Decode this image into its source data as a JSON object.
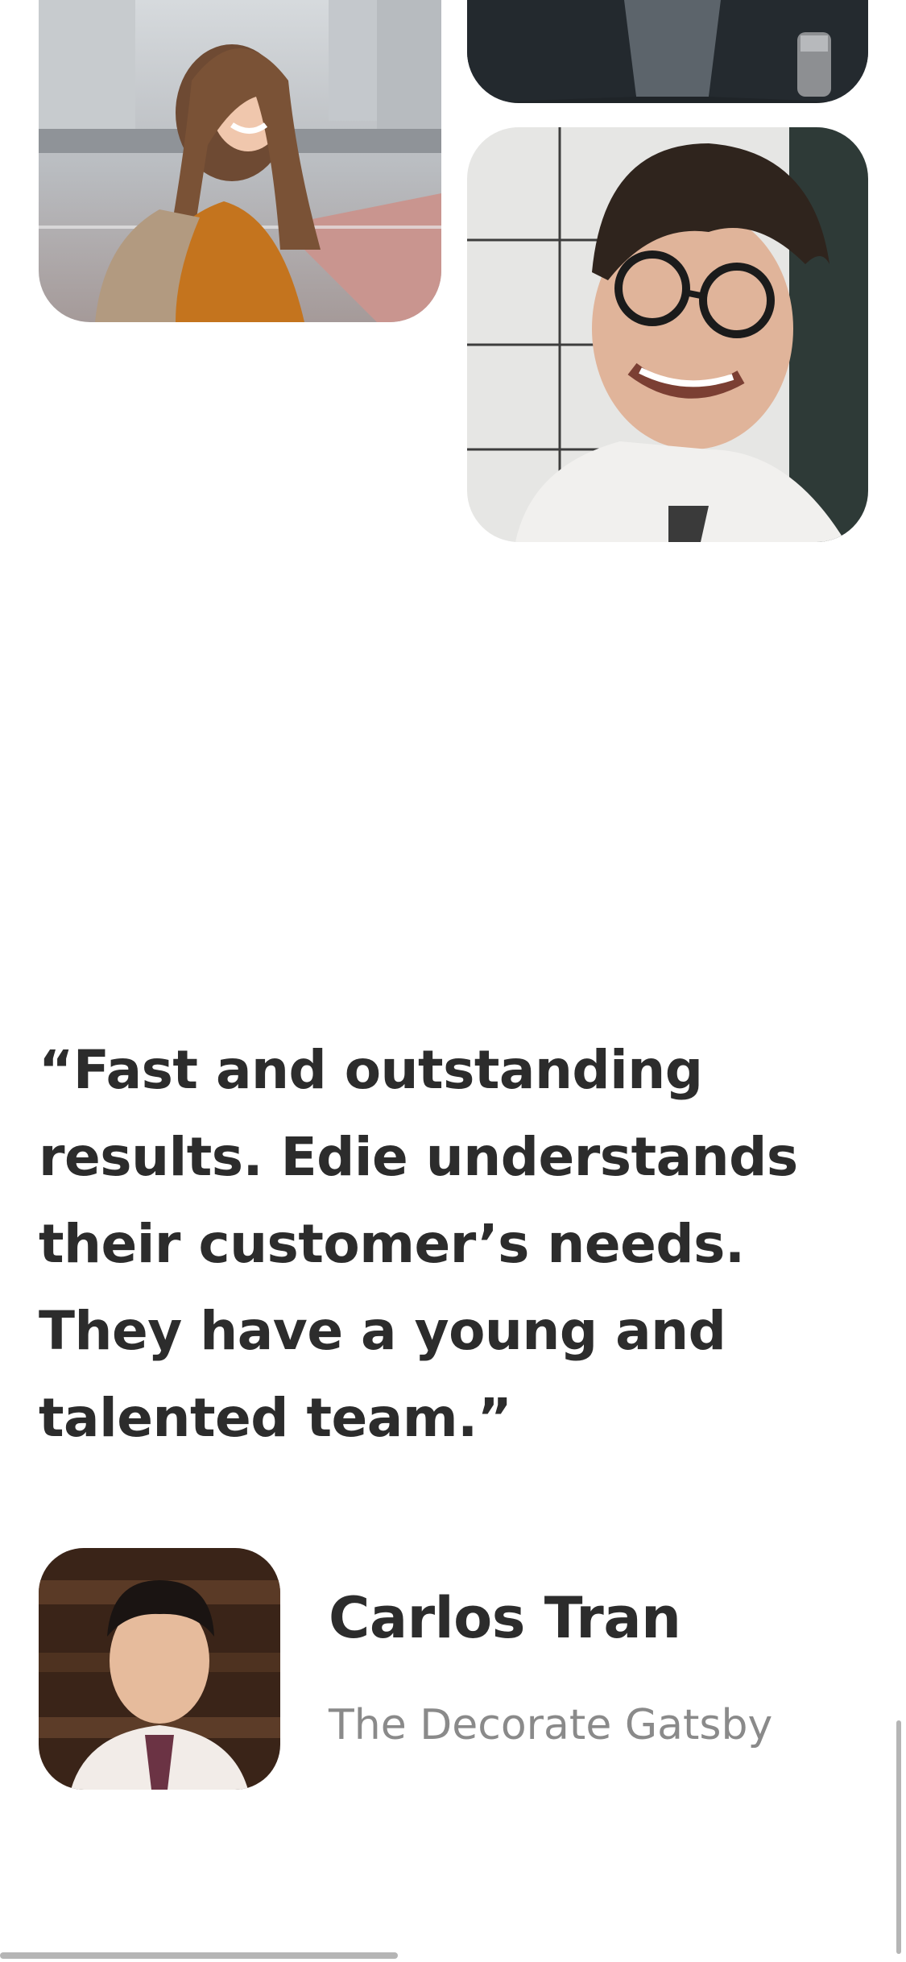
{
  "gallery": {
    "photos": [
      {
        "icon": "photo-woman-smiling"
      },
      {
        "icon": "photo-man-in-suit"
      },
      {
        "icon": "photo-man-with-glasses"
      }
    ]
  },
  "testimonial": {
    "quote": "“Fast and outstanding results. Edie understands their customer’s needs. They have a young and talented team.”",
    "author": {
      "name": "Carlos Tran",
      "company": "The Decorate Gatsby",
      "avatar_icon": "avatar-photo"
    }
  },
  "colors": {
    "text_primary": "#2c2c2c",
    "text_secondary": "#8a8a8a",
    "background": "#ffffff"
  }
}
